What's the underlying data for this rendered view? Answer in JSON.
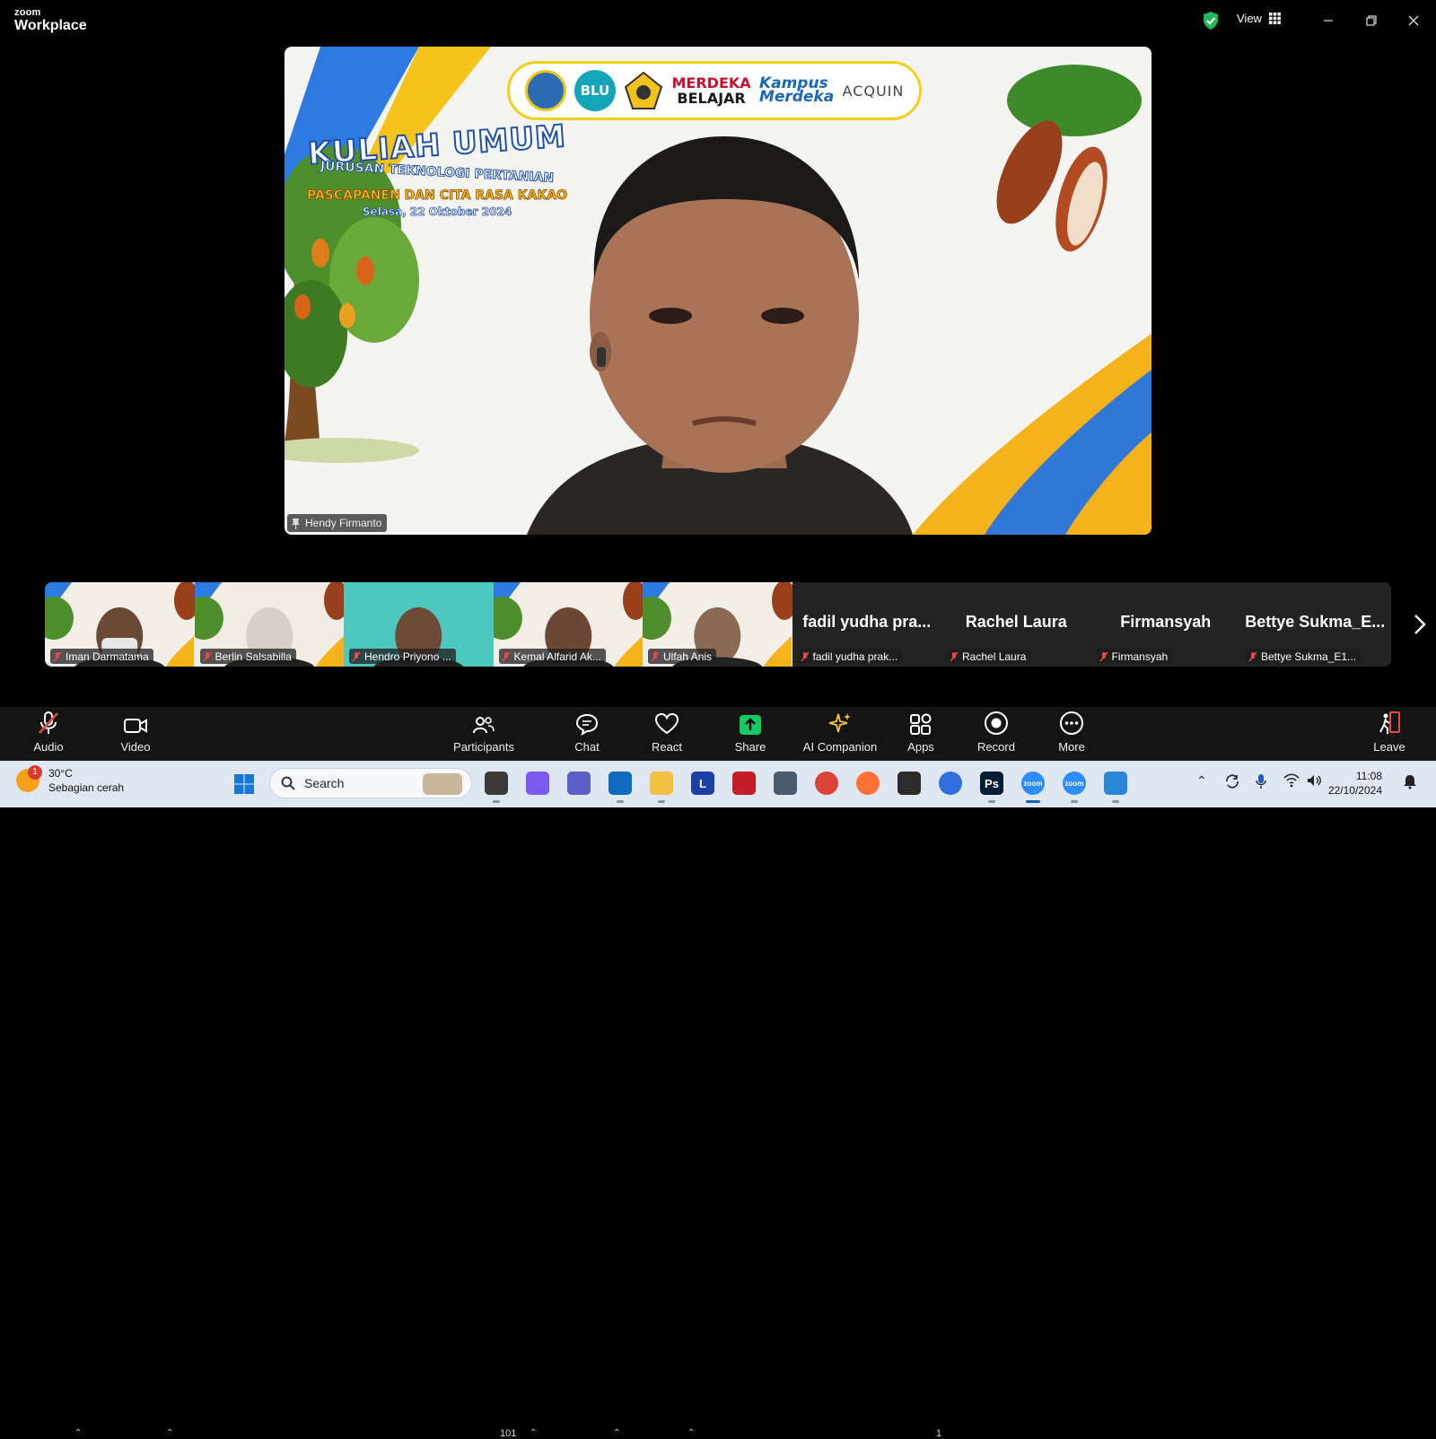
{
  "window": {
    "brand_top": "zoom",
    "brand_bottom": "Workplace",
    "view_label": "View",
    "icons": [
      "shield-check-icon",
      "grid-icon",
      "minimize-icon",
      "restore-icon",
      "close-icon"
    ]
  },
  "speaker": {
    "name": "Hendy Firmanto",
    "background": {
      "logo_text": {
        "blu": "BLU",
        "merdeka_1": "MERDEKA",
        "merdeka_2": "BELAJAR",
        "kampus_1": "Kampus",
        "kampus_2": "Merdeka",
        "acquin": "ACQUIN"
      },
      "title": "KULIAH UMUM",
      "subtitle": "JURUSAN TEKNOLOGI PERTANIAN",
      "topic": "PASCAPANEN DAN CITA RASA KAKAO",
      "date": "Selasa, 22 Oktober 2024"
    }
  },
  "participants": [
    {
      "display": "video",
      "name": "Iman Darmatama"
    },
    {
      "display": "video",
      "name": "Berlin Salsabilla"
    },
    {
      "display": "video",
      "name": "Hendro  Priyono ..."
    },
    {
      "display": "video",
      "name": "Kemal Alfarid Ak..."
    },
    {
      "display": "video",
      "name": "Ulfah Anis"
    },
    {
      "display": "name",
      "big": "fadil  yudha  pra...",
      "name": "fadil yudha prak..."
    },
    {
      "display": "name",
      "big": "Rachel Laura",
      "name": "Rachel Laura"
    },
    {
      "display": "name",
      "big": "Firmansyah",
      "name": "Firmansyah"
    },
    {
      "display": "name",
      "big": "Bettye  Sukma_E...",
      "name": "Bettye Sukma_E1..."
    }
  ],
  "toolbar": {
    "audio": "Audio",
    "video": "Video",
    "participants": "Participants",
    "participants_count": "101",
    "chat": "Chat",
    "react": "React",
    "share": "Share",
    "ai": "AI Companion",
    "apps": "Apps",
    "apps_count": "1",
    "record": "Record",
    "more": "More",
    "leave": "Leave",
    "share_color": "#17c964",
    "leave_color": "#e5484d"
  },
  "taskbar": {
    "weather_badge": "1",
    "temp": "30°C",
    "condition": "Sebagian cerah",
    "search_placeholder": "Search",
    "time": "11:08",
    "date": "22/10/2024",
    "apps": [
      {
        "name": "file-explorer-icon",
        "label": ""
      },
      {
        "name": "copilot-icon",
        "label": ""
      },
      {
        "name": "teams-icon",
        "label": ""
      },
      {
        "name": "outlook-icon",
        "label": ""
      },
      {
        "name": "folder-icon",
        "label": ""
      },
      {
        "name": "l-app-icon",
        "label": "L"
      },
      {
        "name": "shield-app-icon",
        "label": ""
      },
      {
        "name": "network-app-icon",
        "label": ""
      },
      {
        "name": "chrome-icon",
        "label": ""
      },
      {
        "name": "firefox-icon",
        "label": ""
      },
      {
        "name": "reader-app-icon",
        "label": ""
      },
      {
        "name": "browser-icon",
        "label": ""
      },
      {
        "name": "photoshop-icon",
        "label": "Ps"
      },
      {
        "name": "zoom-icon",
        "label": "zoom"
      },
      {
        "name": "zoom-icon-2",
        "label": "zoom"
      },
      {
        "name": "photos-icon",
        "label": ""
      }
    ]
  }
}
